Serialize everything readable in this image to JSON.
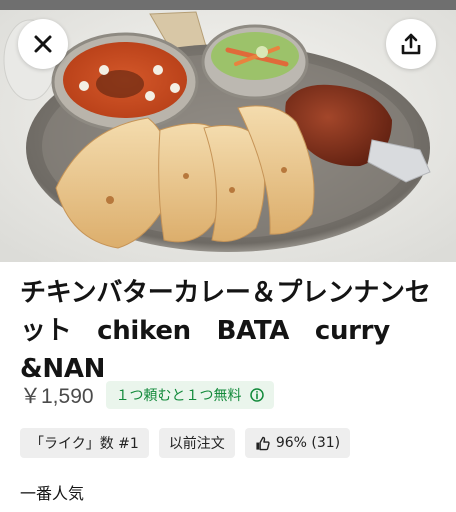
{
  "product": {
    "title": "チキンバターカレー＆プレンナンセット　chiken　BATA　curry　&NAN",
    "price": "￥1,590",
    "promo": "１つ頼むと１つ無料"
  },
  "badges": [
    {
      "label": "「ライク」数 #1"
    },
    {
      "label": "以前注文"
    },
    {
      "label": "96% (31)",
      "icon": "thumbs-up-icon"
    }
  ],
  "section": {
    "label": "一番人気"
  },
  "icons": {
    "close": "close-icon",
    "share": "share-icon",
    "promo_info": "info-icon",
    "rating": "thumbs-up-icon"
  },
  "colors": {
    "promo_text": "#138a3b",
    "promo_bg": "#eaf5ec",
    "chip_bg": "#eeeeee"
  }
}
